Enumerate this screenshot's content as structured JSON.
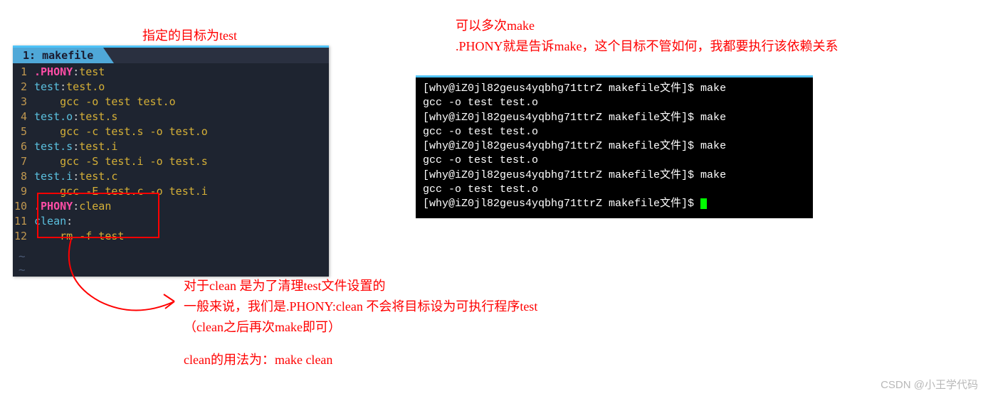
{
  "annotations": {
    "top_left": "指定的目标为test",
    "top_right_l1": "可以多次make",
    "top_right_l2": ".PHONY就是告诉make，这个目标不管如何，我都要执行该依赖关系",
    "bottom_l1": "对于clean 是为了清理test文件设置的",
    "bottom_l2": "一般来说，我们是.PHONY:clean 不会将目标设为可执行程序test",
    "bottom_l3": "（clean之后再次make即可）",
    "bottom_l4": "clean的用法为：make clean"
  },
  "editor": {
    "tab_label": "1: makefile",
    "lines": [
      {
        "num": "1",
        "parts": [
          {
            "text": ".PHONY",
            "cls": "phony"
          },
          {
            "text": ":",
            "cls": "colon"
          },
          {
            "text": "test",
            "cls": "dep"
          }
        ]
      },
      {
        "num": "2",
        "parts": [
          {
            "text": "test",
            "cls": "target"
          },
          {
            "text": ":",
            "cls": "colon"
          },
          {
            "text": "test.o",
            "cls": "dep"
          }
        ]
      },
      {
        "num": "3",
        "parts": [
          {
            "text": "    gcc -o test test.o",
            "cls": "cmd"
          }
        ]
      },
      {
        "num": "4",
        "parts": [
          {
            "text": "test.o",
            "cls": "target"
          },
          {
            "text": ":",
            "cls": "colon"
          },
          {
            "text": "test.s",
            "cls": "dep"
          }
        ]
      },
      {
        "num": "5",
        "parts": [
          {
            "text": "    gcc -c test.s -o test.o",
            "cls": "cmd"
          }
        ]
      },
      {
        "num": "6",
        "parts": [
          {
            "text": "test.s",
            "cls": "target"
          },
          {
            "text": ":",
            "cls": "colon"
          },
          {
            "text": "test.i",
            "cls": "dep"
          }
        ]
      },
      {
        "num": "7",
        "parts": [
          {
            "text": "    gcc -S test.i -o test.s",
            "cls": "cmd"
          }
        ]
      },
      {
        "num": "8",
        "parts": [
          {
            "text": "test.i",
            "cls": "target"
          },
          {
            "text": ":",
            "cls": "colon"
          },
          {
            "text": "test.c",
            "cls": "dep"
          }
        ]
      },
      {
        "num": "9",
        "parts": [
          {
            "text": "    gcc -E test.c -o test.i",
            "cls": "cmd"
          }
        ]
      },
      {
        "num": "10",
        "parts": [
          {
            "text": ".PHONY",
            "cls": "phony"
          },
          {
            "text": ":",
            "cls": "colon"
          },
          {
            "text": "clean",
            "cls": "dep"
          }
        ]
      },
      {
        "num": "11",
        "parts": [
          {
            "text": "clean",
            "cls": "target"
          },
          {
            "text": ":",
            "cls": "colon"
          }
        ]
      },
      {
        "num": "12",
        "parts": [
          {
            "text": "    rm -f test",
            "cls": "cmd"
          }
        ]
      }
    ]
  },
  "terminal": {
    "lines": [
      "[why@iZ0jl82geus4yqbhg71ttrZ makefile文件]$ make",
      "gcc -o test test.o",
      "[why@iZ0jl82geus4yqbhg71ttrZ makefile文件]$ make",
      "gcc -o test test.o",
      "[why@iZ0jl82geus4yqbhg71ttrZ makefile文件]$ make",
      "gcc -o test test.o",
      "[why@iZ0jl82geus4yqbhg71ttrZ makefile文件]$ make",
      "gcc -o test test.o",
      "[why@iZ0jl82geus4yqbhg71ttrZ makefile文件]$ "
    ]
  },
  "watermark": "CSDN @小王学代码"
}
